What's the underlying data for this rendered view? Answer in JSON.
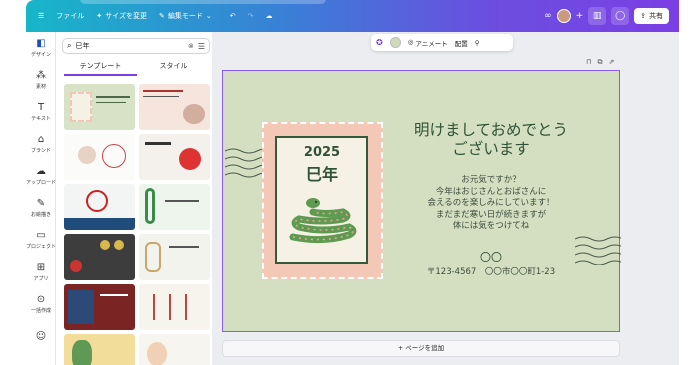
{
  "topbar": {
    "file_label": "ファイル",
    "resize_label": "サイズを変更",
    "edit_mode_label": "編集モード",
    "share_label": "共有",
    "accent": "#7b3fe4"
  },
  "rail": {
    "items": [
      {
        "label": "デザイン",
        "icon": "design-icon"
      },
      {
        "label": "素材",
        "icon": "elements-icon"
      },
      {
        "label": "テキスト",
        "icon": "text-icon"
      },
      {
        "label": "ブランド",
        "icon": "brand-icon"
      },
      {
        "label": "アップロード",
        "icon": "upload-icon"
      },
      {
        "label": "お絵描き",
        "icon": "draw-icon"
      },
      {
        "label": "プロジェクト",
        "icon": "folder-icon"
      },
      {
        "label": "アプリ",
        "icon": "apps-icon"
      },
      {
        "label": "一括作成",
        "icon": "bulk-create-icon"
      }
    ]
  },
  "panel": {
    "search_value": "巳年",
    "tab_templates": "テンプレート",
    "tab_styles": "スタイル"
  },
  "toolbar": {
    "animate_label": "アニメート",
    "position_label": "配置"
  },
  "card": {
    "year": "2025",
    "eto": "巳年",
    "greeting": "明けましておめでとう\nございます",
    "body": "お元気ですか？\n今年はおじさんとおばさんに\n会えるのを楽しみにしています！\nまだまだ寒い日が続きますが\n体には気をつけてね",
    "name": "〇〇",
    "address": "〒123-4567　〇〇市〇〇町1-23",
    "bg_color": "#d3dfc0",
    "text_color": "#315236",
    "stamp_color": "#f3c8b6"
  },
  "canvas": {
    "add_page_label": "+ ページを追加"
  }
}
